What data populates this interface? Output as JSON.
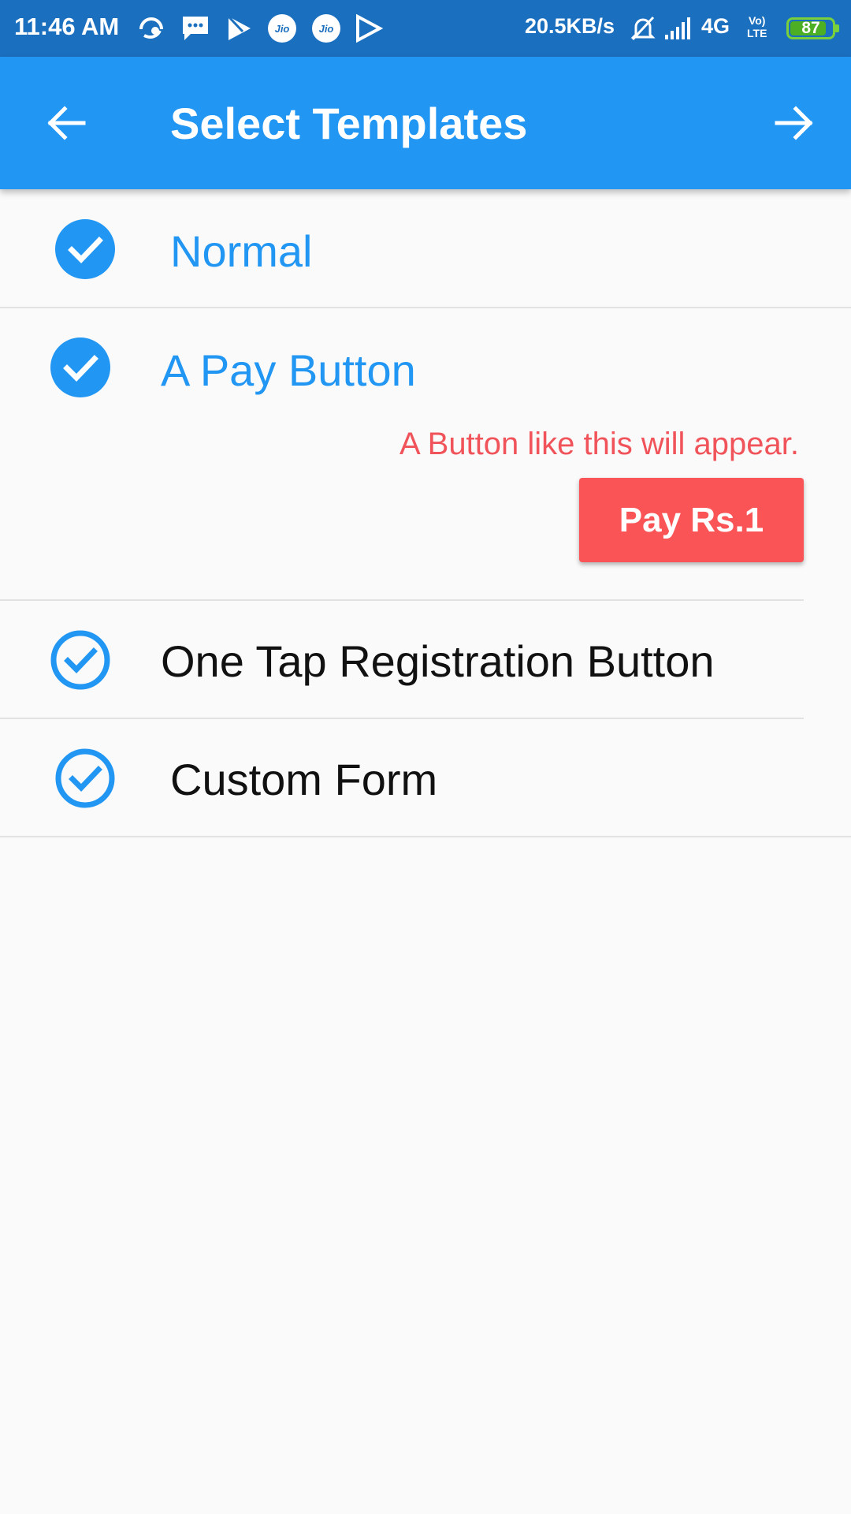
{
  "status_bar": {
    "time": "11:46 AM",
    "speed": "20.5KB/s",
    "network": "4G",
    "volte_line1": "Vo)",
    "volte_line2": "LTE",
    "battery": "87",
    "battery_level": 0.87,
    "jio_1": "Jio",
    "jio_2": "Jio",
    "icons": [
      "uc-browser-icon",
      "messages-icon",
      "play-store-icon",
      "jio-icon",
      "jio-icon",
      "play-store-icon",
      "mute-icon",
      "signal-icon"
    ]
  },
  "app_bar": {
    "title": "Select Templates",
    "back_icon": "arrow-left-icon",
    "next_icon": "arrow-right-icon",
    "color": "#2196f3"
  },
  "templates": [
    {
      "label": "Normal",
      "state": "checked-filled"
    },
    {
      "label": "A Pay Button",
      "state": "checked-filled",
      "hint": "A Button like this will appear.",
      "button_label": "Pay Rs.1"
    },
    {
      "label": "One Tap Registration Button",
      "state": "checked-outline"
    },
    {
      "label": "Custom Form",
      "state": "checked-outline"
    }
  ],
  "colors": {
    "accent": "#2196f3",
    "status_bar": "#1b6fbf",
    "pay_button": "#fa5457",
    "hint_text": "#f0545a"
  }
}
